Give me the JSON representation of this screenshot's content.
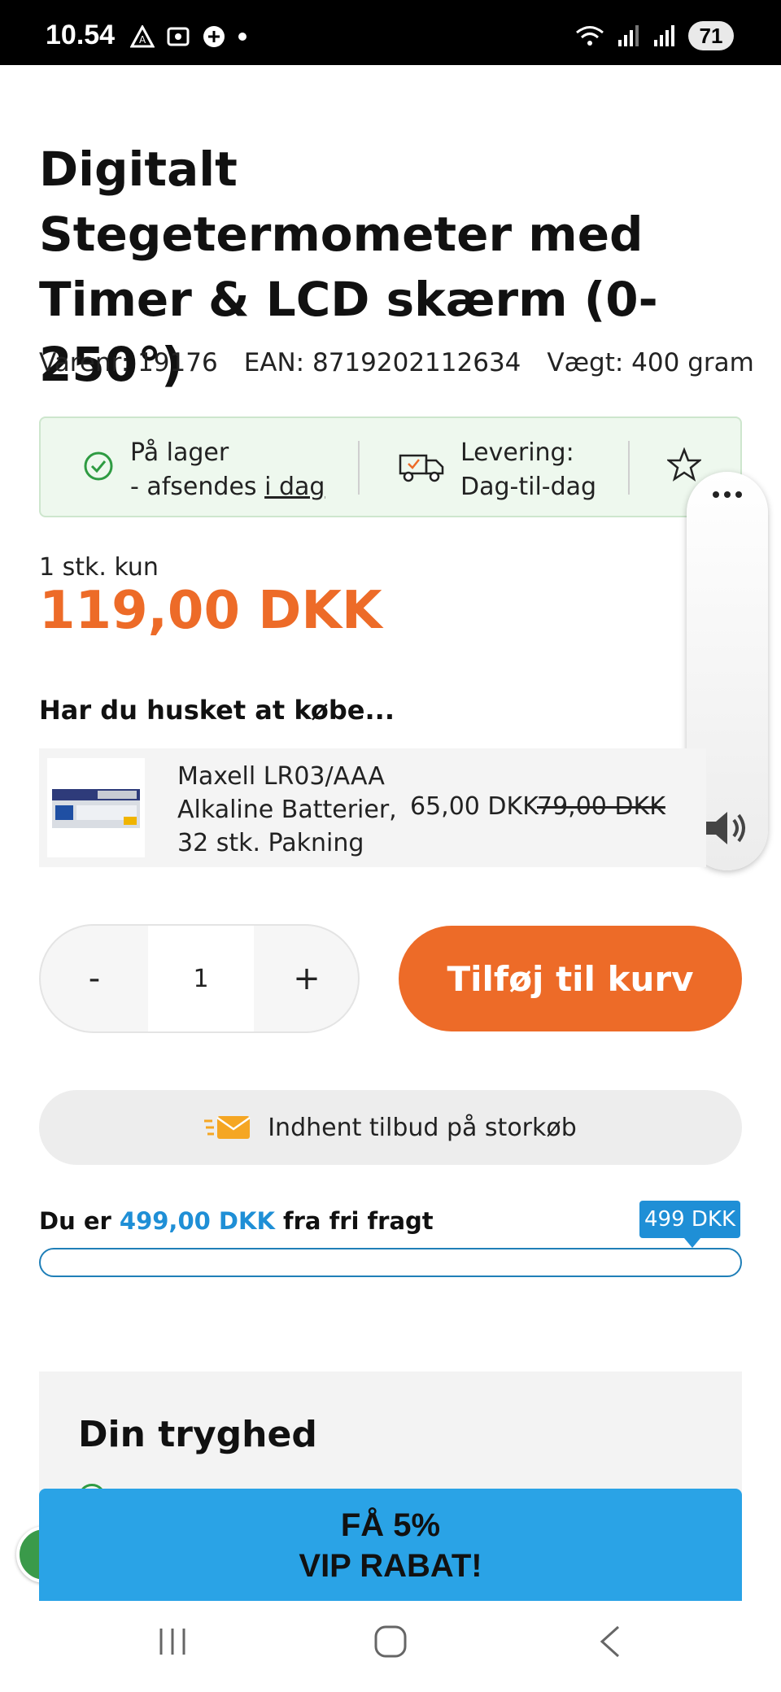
{
  "status_bar": {
    "time": "10.54",
    "battery": "71"
  },
  "product": {
    "title": "Digitalt Stegetermometer med Timer & LCD skærm (0-250°)",
    "varenr": "Varenr: 19176",
    "ean": "EAN: 8719202112634",
    "weight": "Vægt: 400  gram"
  },
  "info": {
    "stock_line1": "På lager",
    "stock_line2_prefix": " - afsendes ",
    "stock_line2_link": "i dag",
    "delivery_line1": "Levering:",
    "delivery_line2": "Dag-til-dag"
  },
  "price": {
    "qty_label": "1 stk. kun",
    "amount": "119,00 DKK"
  },
  "upsell": {
    "heading": "Har du husket at købe...",
    "name_line1": "Maxell LR03/AAA",
    "name_line2": "Alkaline Batterier,",
    "name_line3": "32 stk. Pakning",
    "price": "65,00 DKK",
    "old_price": "79,00 DKK"
  },
  "cart": {
    "minus": "-",
    "quantity": "1",
    "plus": "+",
    "add_label": "Tilføj til kurv"
  },
  "bulk": {
    "label": "Indhent tilbud på storkøb"
  },
  "freight": {
    "prefix": "Du er ",
    "amount": "499,00 DKK",
    "suffix": " fra fri fragt",
    "badge": "499 DKK",
    "progress_fraction": 0.0
  },
  "safety": {
    "heading": "Din tryghed"
  },
  "vip": {
    "line1": "FÅ 5%",
    "line2": "VIP RABAT!"
  },
  "colors": {
    "accent_orange": "#ed6b28",
    "accent_blue": "#1f8fd6",
    "stock_green": "#2e9b42"
  }
}
